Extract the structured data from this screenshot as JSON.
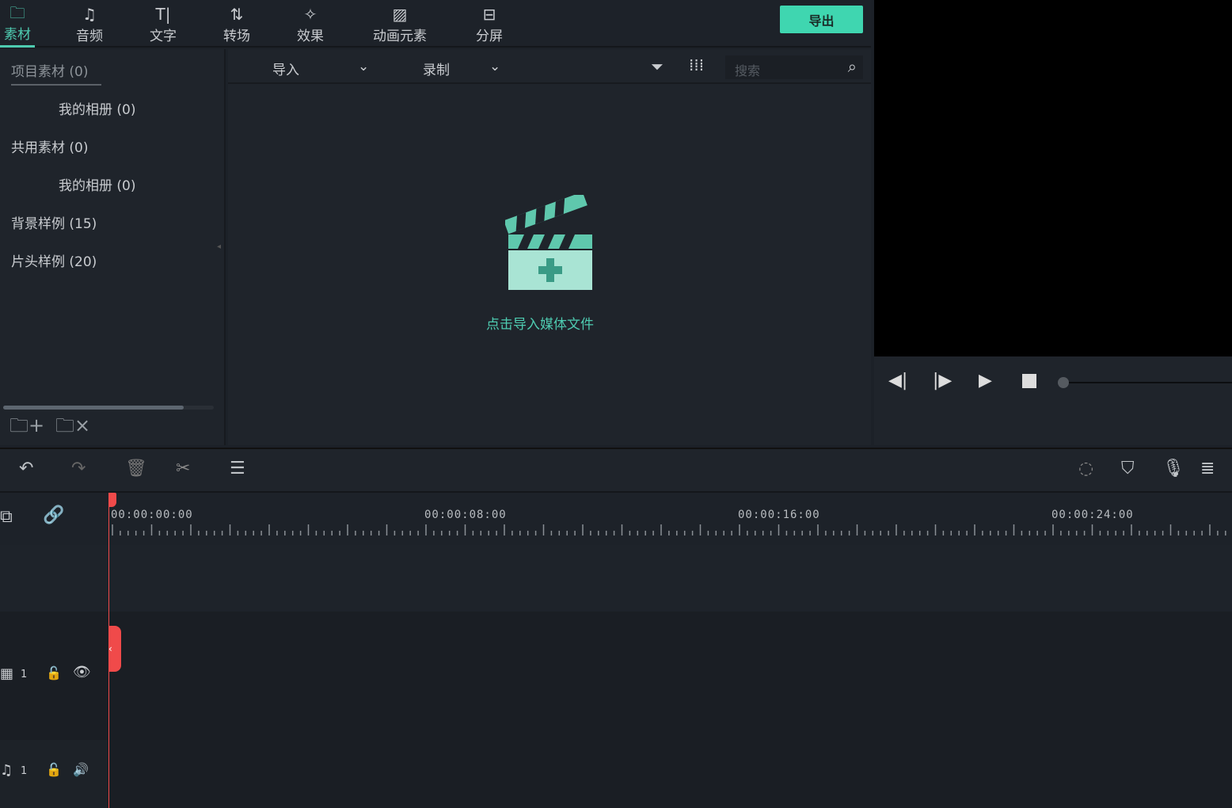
{
  "nav": {
    "tabs": [
      {
        "label": "素材",
        "icon": "folder-icon",
        "active": true
      },
      {
        "label": "音频",
        "icon": "music-note-icon"
      },
      {
        "label": "文字",
        "icon": "text-icon"
      },
      {
        "label": "转场",
        "icon": "transition-icon"
      },
      {
        "label": "效果",
        "icon": "effects-icon"
      },
      {
        "label": "动画元素",
        "icon": "image-icon"
      },
      {
        "label": "分屏",
        "icon": "split-screen-icon"
      }
    ],
    "export_label": "导出"
  },
  "sidebar": {
    "items": [
      {
        "label": "项目素材 (0)"
      },
      {
        "label": "我的相册 (0)"
      },
      {
        "label": "共用素材 (0)"
      },
      {
        "label": "我的相册 (0)"
      },
      {
        "label": "背景样例 (15)"
      },
      {
        "label": "片头样例 (20)"
      }
    ]
  },
  "media": {
    "import_label": "导入",
    "record_label": "录制",
    "search_placeholder": "搜索",
    "empty_prompt": "点击导入媒体文件"
  },
  "colors": {
    "accent": "#4ecbb0",
    "playhead": "#f04a4a"
  },
  "timeline": {
    "ruler_labels": [
      "00:00:00:00",
      "00:00:08:00",
      "00:00:16:00",
      "00:00:24:00"
    ],
    "tracks": [
      {
        "type": "video",
        "number": "1"
      },
      {
        "type": "audio",
        "number": "1"
      }
    ]
  }
}
